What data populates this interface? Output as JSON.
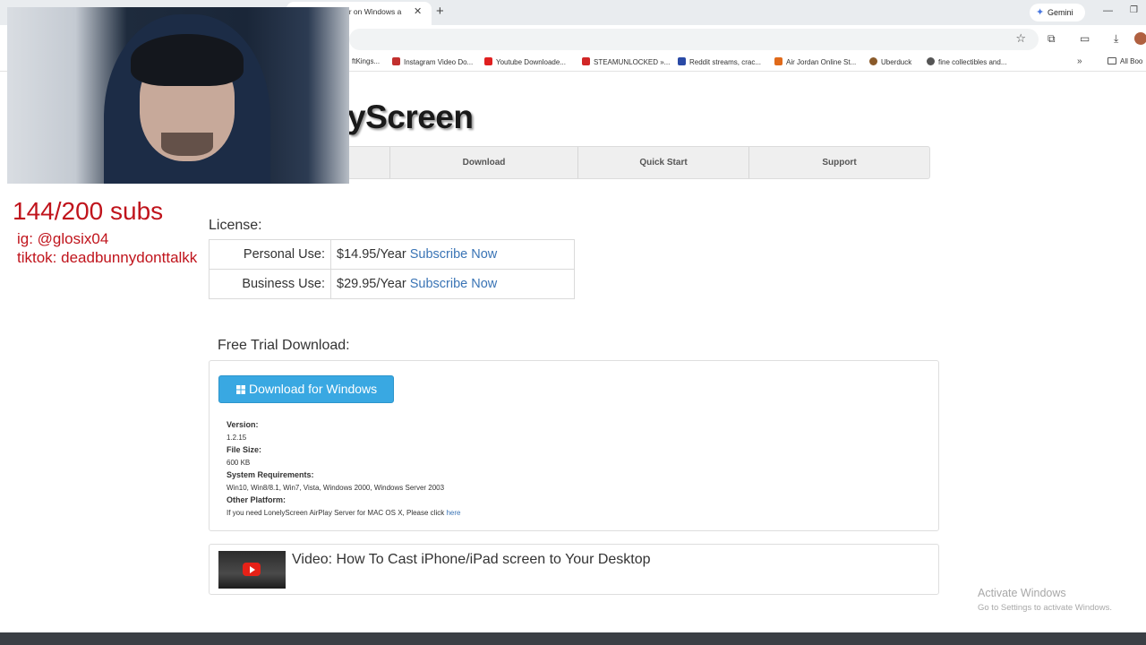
{
  "browser": {
    "active_tab_title": "er on Windows a",
    "gemini_label": "Gemini",
    "bookmarks": [
      {
        "label": "ftKings...",
        "color": "#2a2a2a"
      },
      {
        "label": "Instagram Video Do...",
        "color": "#c2302e"
      },
      {
        "label": "Youtube Downloade...",
        "color": "#e02020"
      },
      {
        "label": "STEAMUNLOCKED »...",
        "color": "#d12626"
      },
      {
        "label": "Reddit streams, crac...",
        "color": "#2a4aa6"
      },
      {
        "label": "Air Jordan Online St...",
        "color": "#e06a1a"
      },
      {
        "label": "Uberduck",
        "color": "#8a5a2a"
      },
      {
        "label": "fine collectibles and...",
        "color": "#555555"
      }
    ],
    "all_bookmarks_label": "All Boo"
  },
  "site": {
    "logo_text": "yScreen",
    "nav": [
      "Download",
      "Quick Start",
      "Support"
    ],
    "license_heading": "License:",
    "license": [
      {
        "label": "Personal Use:",
        "price": "$14.95/Year",
        "cta": "Subscribe Now"
      },
      {
        "label": "Business Use:",
        "price": "$29.95/Year",
        "cta": "Subscribe Now"
      }
    ],
    "trial_heading": "Free Trial Download:",
    "download_button": "Download for Windows",
    "version_label": "Version:",
    "version_value": "1.2.15",
    "filesize_label": "File Size:",
    "filesize_value": "600 KB",
    "sysreq_label": "System Requirements:",
    "sysreq_value": "Win10, Win8/8.1, Win7, Vista, Windows 2000, Windows Server 2003",
    "other_label": "Other Platform:",
    "other_text": "If you need LonelyScreen AirPlay Server for MAC OS X, Please click ",
    "other_link": "here",
    "video_title": "Video: How To Cast iPhone/iPad screen to Your Desktop"
  },
  "os": {
    "activate_title": "Activate Windows",
    "activate_sub": "Go to Settings to activate Windows."
  },
  "overlay": {
    "subs": "144/200 subs",
    "ig": "ig: @glosix04",
    "tiktok": "tiktok: deadbunnydonttalkk"
  },
  "colors": {
    "link": "#3a74b5",
    "download_button": "#39a8e2",
    "overlay_text": "#c0141c"
  }
}
